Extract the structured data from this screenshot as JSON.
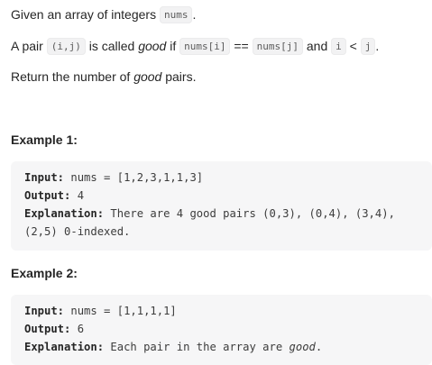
{
  "description": {
    "line1": {
      "before": "Given an array of integers ",
      "code": "nums",
      "after": "."
    },
    "line2": {
      "prefix": "A pair ",
      "pair_code": "(i,j)",
      "is_called": " is called ",
      "good": "good",
      "if_text": " if ",
      "expr_left": "nums[i]",
      "eq": " == ",
      "expr_right": "nums[j]",
      "and": " and ",
      "i_code": "i",
      "lt": " < ",
      "j_code": "j",
      "period": "."
    },
    "line3": {
      "before": "Return the number of ",
      "good": "good",
      "after": " pairs."
    }
  },
  "examples": [
    {
      "title": "Example 1:",
      "input_label": "Input:",
      "input_value": " nums = [1,2,3,1,1,3]",
      "output_label": "Output:",
      "output_value": " 4",
      "explanation_label": "Explanation:",
      "explanation_line1": " There are 4 good pairs (0,3), (0,4), (3,4),",
      "explanation_line2": "(2,5) 0-indexed."
    },
    {
      "title": "Example 2:",
      "input_label": "Input:",
      "input_value": " nums = [1,1,1,1]",
      "output_label": "Output:",
      "output_value": " 6",
      "explanation_label": "Explanation:",
      "explanation_before": " Each pair in the array are ",
      "explanation_em": "good",
      "explanation_after": "."
    }
  ]
}
